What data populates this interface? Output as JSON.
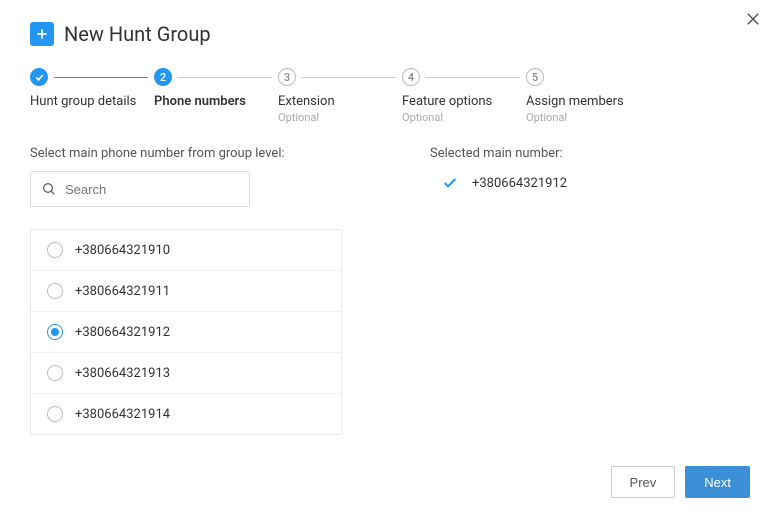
{
  "header": {
    "title": "New Hunt Group"
  },
  "stepper": {
    "steps": [
      {
        "label": "Hunt group details",
        "sublabel": "",
        "state": "completed"
      },
      {
        "label": "Phone numbers",
        "sublabel": "",
        "state": "active"
      },
      {
        "label": "Extension",
        "sublabel": "Optional",
        "state": "pending",
        "number": "3"
      },
      {
        "label": "Feature options",
        "sublabel": "Optional",
        "state": "pending",
        "number": "4"
      },
      {
        "label": "Assign members",
        "sublabel": "Optional",
        "state": "pending",
        "number": "5"
      }
    ]
  },
  "left": {
    "label": "Select main phone number from group level:",
    "search_placeholder": "Search",
    "numbers": [
      {
        "value": "+380664321910",
        "selected": false
      },
      {
        "value": "+380664321911",
        "selected": false
      },
      {
        "value": "+380664321912",
        "selected": true
      },
      {
        "value": "+380664321913",
        "selected": false
      },
      {
        "value": "+380664321914",
        "selected": false
      }
    ]
  },
  "right": {
    "label": "Selected main number:",
    "selected": "+380664321912"
  },
  "footer": {
    "prev": "Prev",
    "next": "Next"
  }
}
